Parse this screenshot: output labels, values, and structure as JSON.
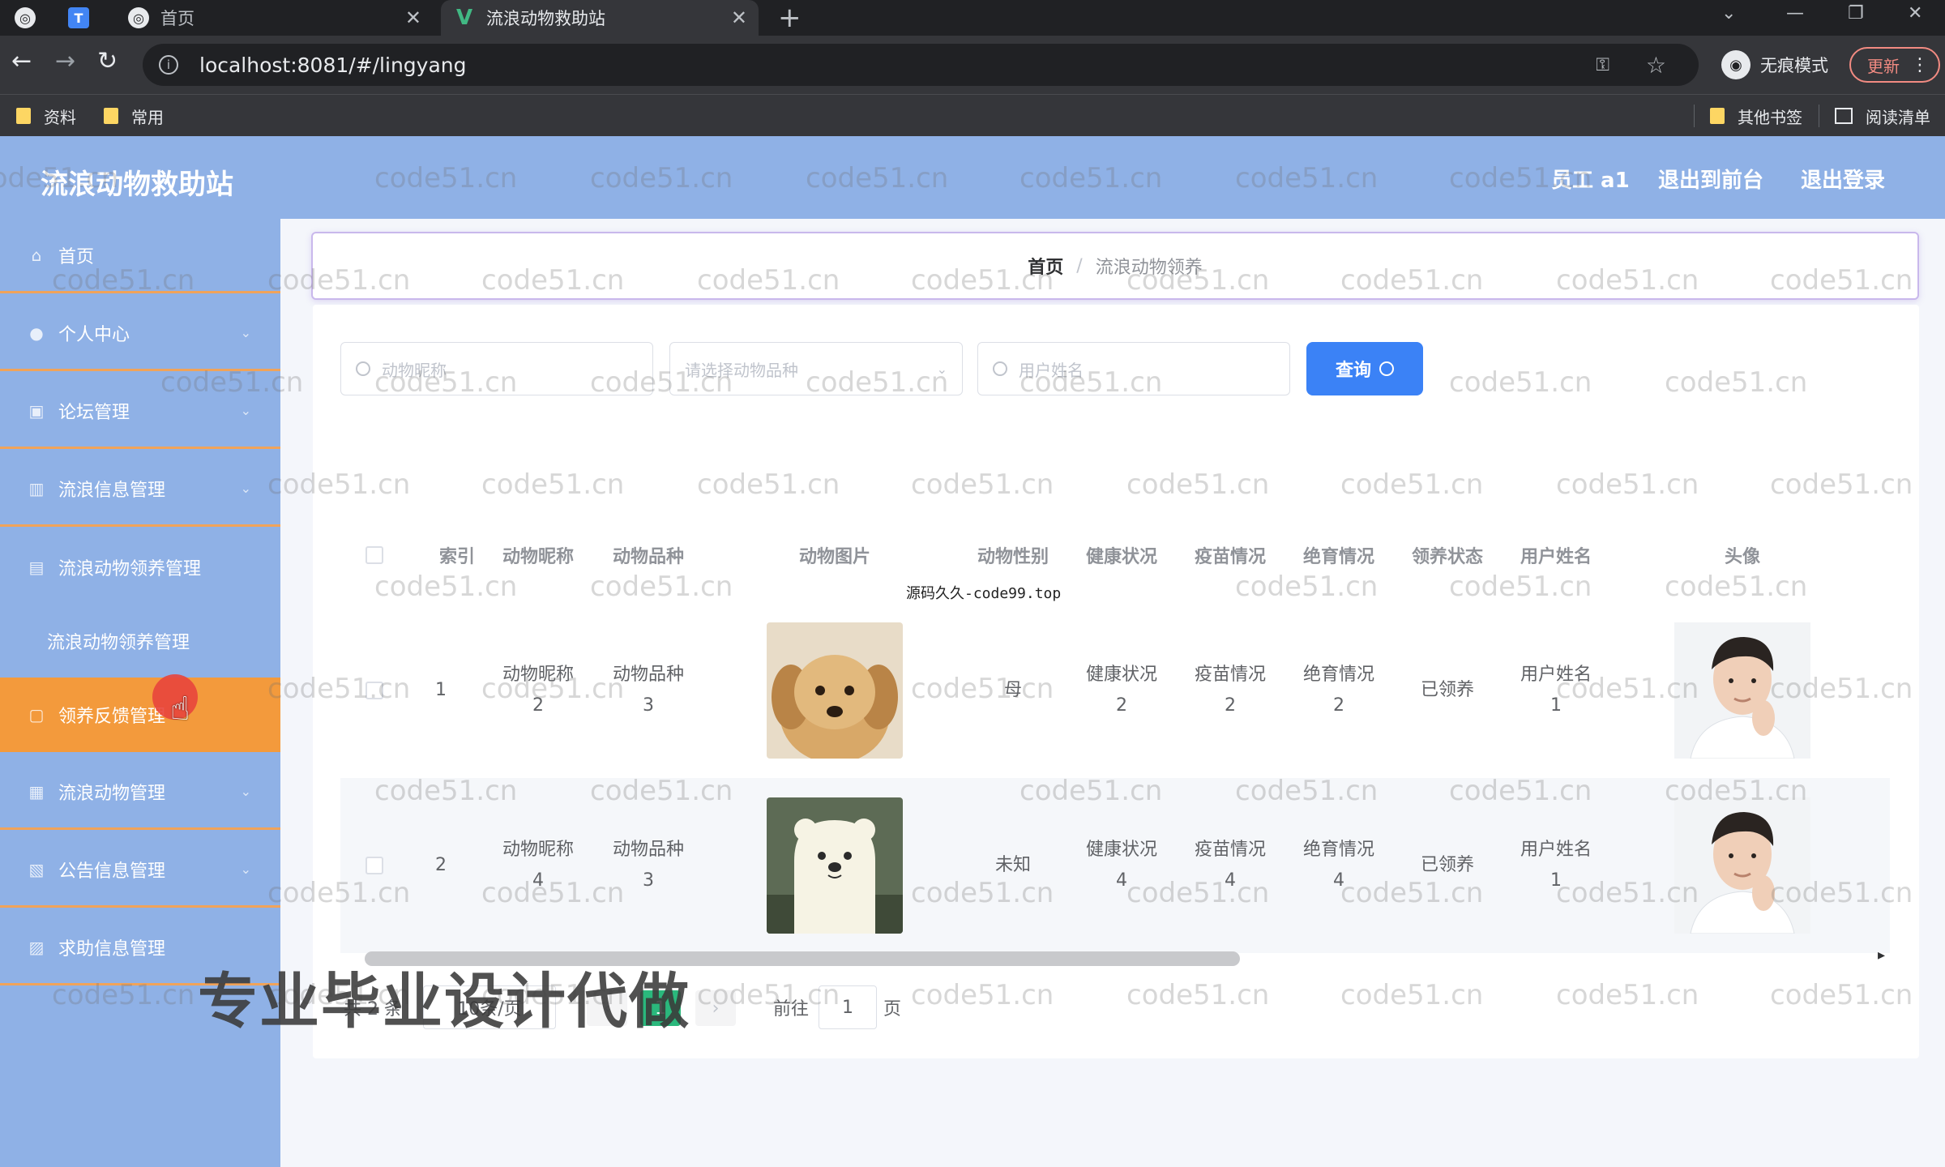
{
  "browser": {
    "tabs": [
      {
        "label": "",
        "icon": "globe-icon"
      },
      {
        "label": "",
        "icon": "app-icon"
      },
      {
        "label": "首页",
        "icon": "globe-icon"
      },
      {
        "label": "流浪动物救助站",
        "icon": "vue-icon"
      }
    ],
    "url": "localhost:8081/#/lingyang",
    "incognito_label": "无痕模式",
    "update_label": "更新",
    "bookmarks": [
      "资料",
      "常用"
    ],
    "bookmarks_right": [
      "其他书签",
      "阅读清单"
    ]
  },
  "app": {
    "title": "流浪动物救助站",
    "header_links": [
      "员工 a1",
      "退出到前台",
      "退出登录"
    ]
  },
  "sidebar": {
    "items": [
      {
        "label": "首页",
        "icon": "home-icon"
      },
      {
        "label": "个人中心",
        "icon": "user-icon"
      },
      {
        "label": "论坛管理",
        "icon": "forum-icon"
      },
      {
        "label": "流浪信息管理",
        "icon": "chart-icon"
      },
      {
        "label": "流浪动物领养管理",
        "icon": "pet-icon"
      },
      {
        "label": "领养反馈管理",
        "icon": "feedback-icon"
      },
      {
        "label": "流浪动物管理",
        "icon": "animal-icon"
      },
      {
        "label": "公告信息管理",
        "icon": "notice-icon"
      },
      {
        "label": "求助信息管理",
        "icon": "help-icon"
      }
    ],
    "submenu": [
      "流浪动物领养管理"
    ]
  },
  "breadcrumb": {
    "home": "首页",
    "current": "流浪动物领养"
  },
  "search": {
    "nickname_placeholder": "动物昵称",
    "breed_placeholder": "请选择动物品种",
    "username_placeholder": "用户姓名",
    "query_label": "查询"
  },
  "table": {
    "headers": [
      "索引",
      "动物昵称",
      "动物品种",
      "动物图片",
      "动物性别",
      "健康状况",
      "疫苗情况",
      "绝育情况",
      "领养状态",
      "用户姓名",
      "头像"
    ],
    "rows": [
      {
        "index": "1",
        "nickname": "动物昵称\n2",
        "breed": "动物品种\n3",
        "image": "puppy",
        "gender": "母",
        "health": "健康状况\n2",
        "vaccine": "疫苗情况\n2",
        "neuter": "绝育情况\n2",
        "status": "已领养",
        "user": "用户姓名\n1",
        "avatar": "man-portrait"
      },
      {
        "index": "2",
        "nickname": "动物昵称\n4",
        "breed": "动物品种\n3",
        "image": "bear",
        "gender": "未知",
        "health": "健康状况\n4",
        "vaccine": "疫苗情况\n4",
        "neuter": "绝育情况\n4",
        "status": "已领养",
        "user": "用户姓名\n1",
        "avatar": "man-portrait"
      }
    ]
  },
  "pager": {
    "total": "共 2 条",
    "page_size": "10条/页",
    "current_page": "1",
    "goto_prefix": "前往",
    "goto_value": "1",
    "goto_suffix": "页"
  },
  "overlays": {
    "watermark": "code51.cn",
    "promo": "专业毕业设计代做",
    "source": "源码久久-code99.top"
  },
  "colors": {
    "sidebar_bg": "#8fb1e6",
    "active_menu": "#f39a3c",
    "query_button": "#3b82f6",
    "pager_active": "#2ab87c"
  }
}
